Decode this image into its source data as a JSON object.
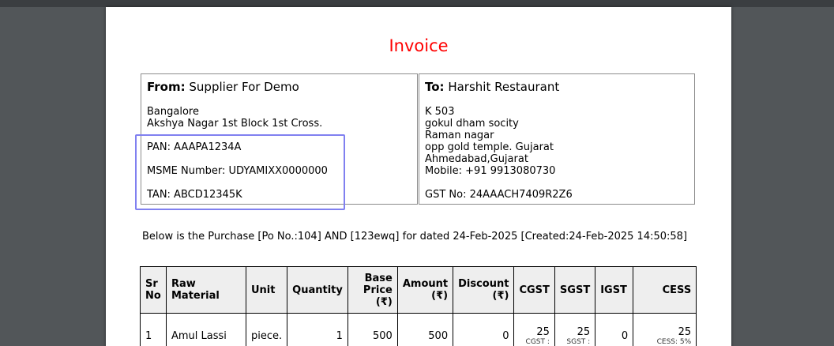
{
  "invoice": {
    "title": "Invoice"
  },
  "from": {
    "label": "From:",
    "name": "Supplier For Demo",
    "lines": [
      "Bangalore",
      "Akshya Nagar 1st Block 1st Cross."
    ],
    "pan": "PAN: AAAPA1234A",
    "msme": "MSME Number: UDYAMIXX0000000",
    "tan": "TAN: ABCD12345K"
  },
  "to": {
    "label": "To:",
    "name": "Harshit Restaurant",
    "lines": [
      "K 503",
      "gokul dham socity",
      "Raman nagar",
      "opp gold temple. Gujarat",
      "Ahmedabad,Gujarat",
      "Mobile: +91 9913080730"
    ],
    "gst": "GST No: 24AAACH7409R2Z6"
  },
  "summary": "Below is the Purchase [Po No.:104] AND [123ewq] for dated 24-Feb-2025 [Created:24-Feb-2025 14:50:58]",
  "table": {
    "headers": {
      "sr": [
        "Sr",
        "No"
      ],
      "raw": [
        "Raw",
        "Material"
      ],
      "unit": "Unit",
      "quantity": "Quantity",
      "base": [
        "Base",
        "Price",
        "(₹)"
      ],
      "amount": [
        "Amount",
        "(₹)"
      ],
      "discount": [
        "Discount",
        "(₹)"
      ],
      "cgst": "CGST",
      "sgst": "SGST",
      "igst": "IGST",
      "cess": "CESS"
    },
    "rows": [
      {
        "sr": "1",
        "raw": "Amul Lassi",
        "unit": "piece.",
        "quantity": "1",
        "base": "500",
        "amount": "500",
        "discount": "0",
        "cgst": "25",
        "cgst_label": "CGST :",
        "sgst": "25",
        "sgst_label": "SGST :",
        "igst": "0",
        "cess": "25",
        "cess_label": "CESS: 5%"
      }
    ]
  }
}
